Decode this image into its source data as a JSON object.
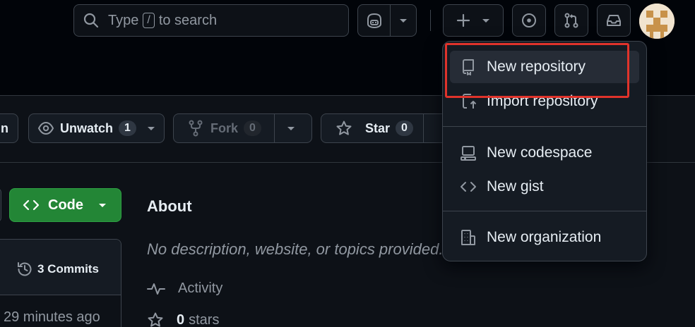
{
  "header": {
    "search_prefix": "Type",
    "search_key": "/",
    "search_suffix": "to search"
  },
  "repo_actions": {
    "unwatch_label": "Unwatch",
    "unwatch_count": "1",
    "fork_label": "Fork",
    "fork_count": "0",
    "star_label": "Star",
    "star_count": "0",
    "left_cut_label": "n"
  },
  "code_button": {
    "label": "Code"
  },
  "file_box": {
    "commits_label": "3 Commits",
    "time_ago": "29 minutes ago"
  },
  "about": {
    "title": "About",
    "description": "No description, website, or topics provided.",
    "activity_label": "Activity",
    "stars_count": "0",
    "stars_label": "stars"
  },
  "create_menu": {
    "items": [
      {
        "label": "New repository",
        "icon": "repo-icon"
      },
      {
        "label": "Import repository",
        "icon": "repo-push-icon"
      },
      {
        "label": "New codespace",
        "icon": "codespaces-icon"
      },
      {
        "label": "New gist",
        "icon": "code-icon"
      },
      {
        "label": "New organization",
        "icon": "organization-icon"
      }
    ],
    "highlighted": "New repository"
  },
  "colors": {
    "background": "#0d1117",
    "header_background": "#010409",
    "code_button": "#238636",
    "highlight_box": "#e0332b"
  }
}
